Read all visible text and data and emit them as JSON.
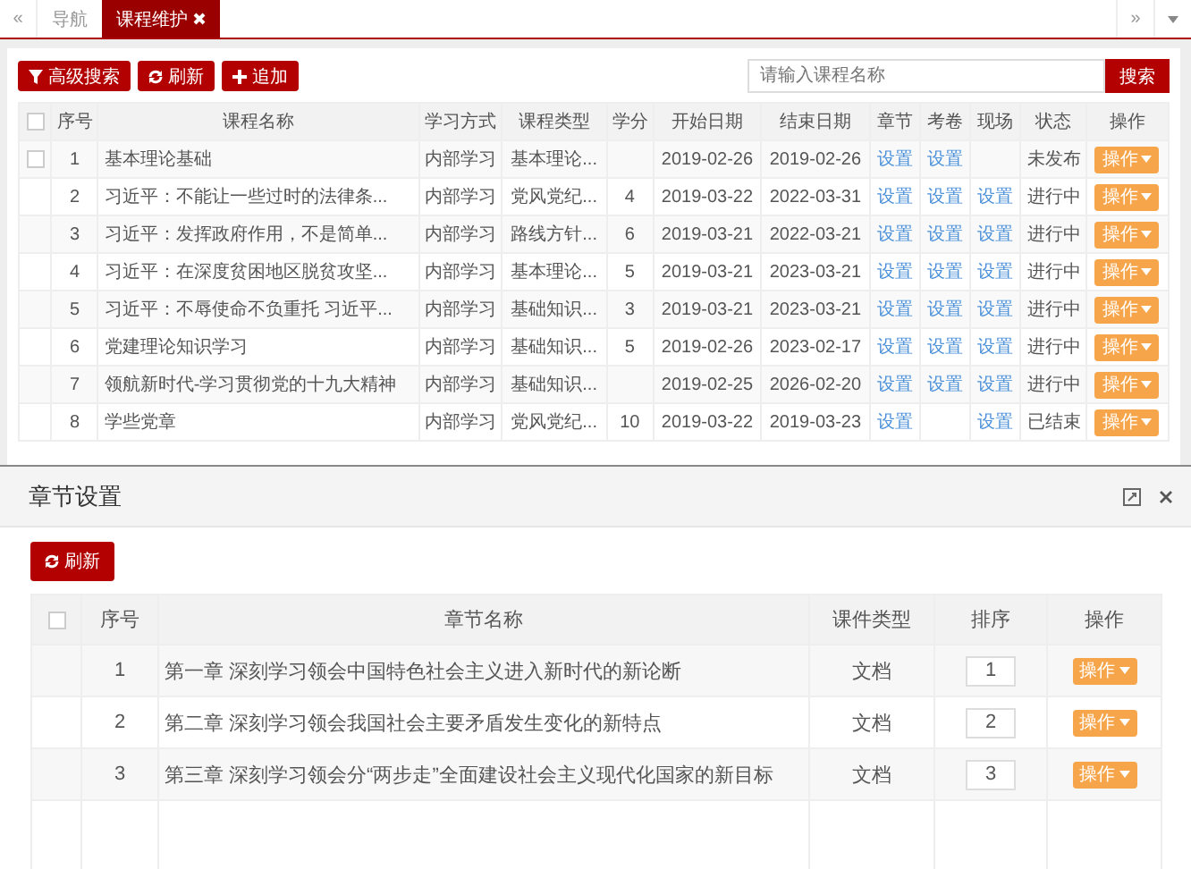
{
  "tab_bar": {
    "nav_left": "«",
    "nav_right": "»",
    "tabs": [
      {
        "label": "导航",
        "selected": false
      },
      {
        "label": "课程维护",
        "selected": true
      }
    ]
  },
  "toolbar": {
    "buttons": [
      {
        "label": "高级搜索",
        "kind": "filter"
      },
      {
        "label": "刷新",
        "kind": "refresh"
      },
      {
        "label": "追加",
        "kind": "add"
      }
    ],
    "search": {
      "placeholder": "请输入课程名称",
      "button": "搜索"
    }
  },
  "course_table": {
    "header_checked": false,
    "columns": [
      "序号",
      "课程名称",
      "学习方式",
      "课程类型",
      "学分",
      "开始日期",
      "结束日期",
      "章节",
      "考卷",
      "现场",
      "状态",
      "操作"
    ],
    "rows": [
      {
        "has_checkbox": true,
        "checked": false,
        "index": "1",
        "name": "基本理论基础",
        "mode": "内部学习",
        "type": "基本理论...",
        "start": "2019-02-26",
        "end": "2019-02-26",
        "chapter": "设置",
        "exam": "设置",
        "status": "未发布",
        "action": "操作"
      },
      {
        "has_checkbox": false,
        "index": "2",
        "name": "习近平：不能让一些过时的法律条...",
        "mode": "内部学习",
        "type": "党风党纪...",
        "credit": "4",
        "start": "2019-03-22",
        "end": "2022-03-31",
        "chapter": "设置",
        "exam": "设置",
        "onsite": "设置",
        "status": "进行中",
        "action": "操作"
      },
      {
        "has_checkbox": false,
        "index": "3",
        "name": "习近平：发挥政府作用，不是简单...",
        "mode": "内部学习",
        "type": "路线方针...",
        "credit": "6",
        "start": "2019-03-21",
        "end": "2022-03-21",
        "chapter": "设置",
        "exam": "设置",
        "onsite": "设置",
        "status": "进行中",
        "action": "操作"
      },
      {
        "has_checkbox": false,
        "index": "4",
        "name": "习近平：在深度贫困地区脱贫攻坚...",
        "mode": "内部学习",
        "type": "基本理论...",
        "credit": "5",
        "start": "2019-03-21",
        "end": "2023-03-21",
        "chapter": "设置",
        "exam": "设置",
        "onsite": "设置",
        "status": "进行中",
        "action": "操作"
      },
      {
        "has_checkbox": false,
        "index": "5",
        "name": "习近平：不辱使命不负重托 习近平...",
        "mode": "内部学习",
        "type": "基础知识...",
        "credit": "3",
        "start": "2019-03-21",
        "end": "2023-03-21",
        "chapter": "设置",
        "exam": "设置",
        "onsite": "设置",
        "status": "进行中",
        "action": "操作"
      },
      {
        "has_checkbox": false,
        "index": "6",
        "name": "党建理论知识学习",
        "mode": "内部学习",
        "type": "基础知识...",
        "credit": "5",
        "start": "2019-02-26",
        "end": "2023-02-17",
        "chapter": "设置",
        "exam": "设置",
        "onsite": "设置",
        "status": "进行中",
        "action": "操作"
      },
      {
        "has_checkbox": false,
        "index": "7",
        "name": "领航新时代-学习贯彻党的十九大精神",
        "mode": "内部学习",
        "type": "基础知识...",
        "start": "2019-02-25",
        "end": "2026-02-20",
        "chapter": "设置",
        "exam": "设置",
        "onsite": "设置",
        "status": "进行中",
        "action": "操作"
      },
      {
        "has_checkbox": false,
        "index": "8",
        "name": "学些党章",
        "mode": "内部学习",
        "type": "党风党纪...",
        "credit": "10",
        "start": "2019-03-22",
        "end": "2019-03-23",
        "chapter": "设置",
        "onsite": "设置",
        "status": "已结束",
        "action": "操作"
      }
    ]
  },
  "dialog": {
    "title": "章节设置",
    "header_checked": false,
    "refresh_button": "刷新",
    "columns": [
      "序号",
      "章节名称",
      "课件类型",
      "排序",
      "操作"
    ],
    "rows": [
      {
        "index": "1",
        "name": "第一章 深刻学习领会中国特色社会主义进入新时代的新论断",
        "type": "文档",
        "order": "1",
        "action": "操作"
      },
      {
        "index": "2",
        "name": "第二章 深刻学习领会我国社会主要矛盾发生变化的新特点",
        "type": "文档",
        "order": "2",
        "action": "操作"
      },
      {
        "index": "3",
        "name": "第三章 深刻学习领会分“两步走”全面建设社会主义现代化国家的新目标",
        "type": "文档",
        "order": "3",
        "action": "操作"
      }
    ]
  }
}
